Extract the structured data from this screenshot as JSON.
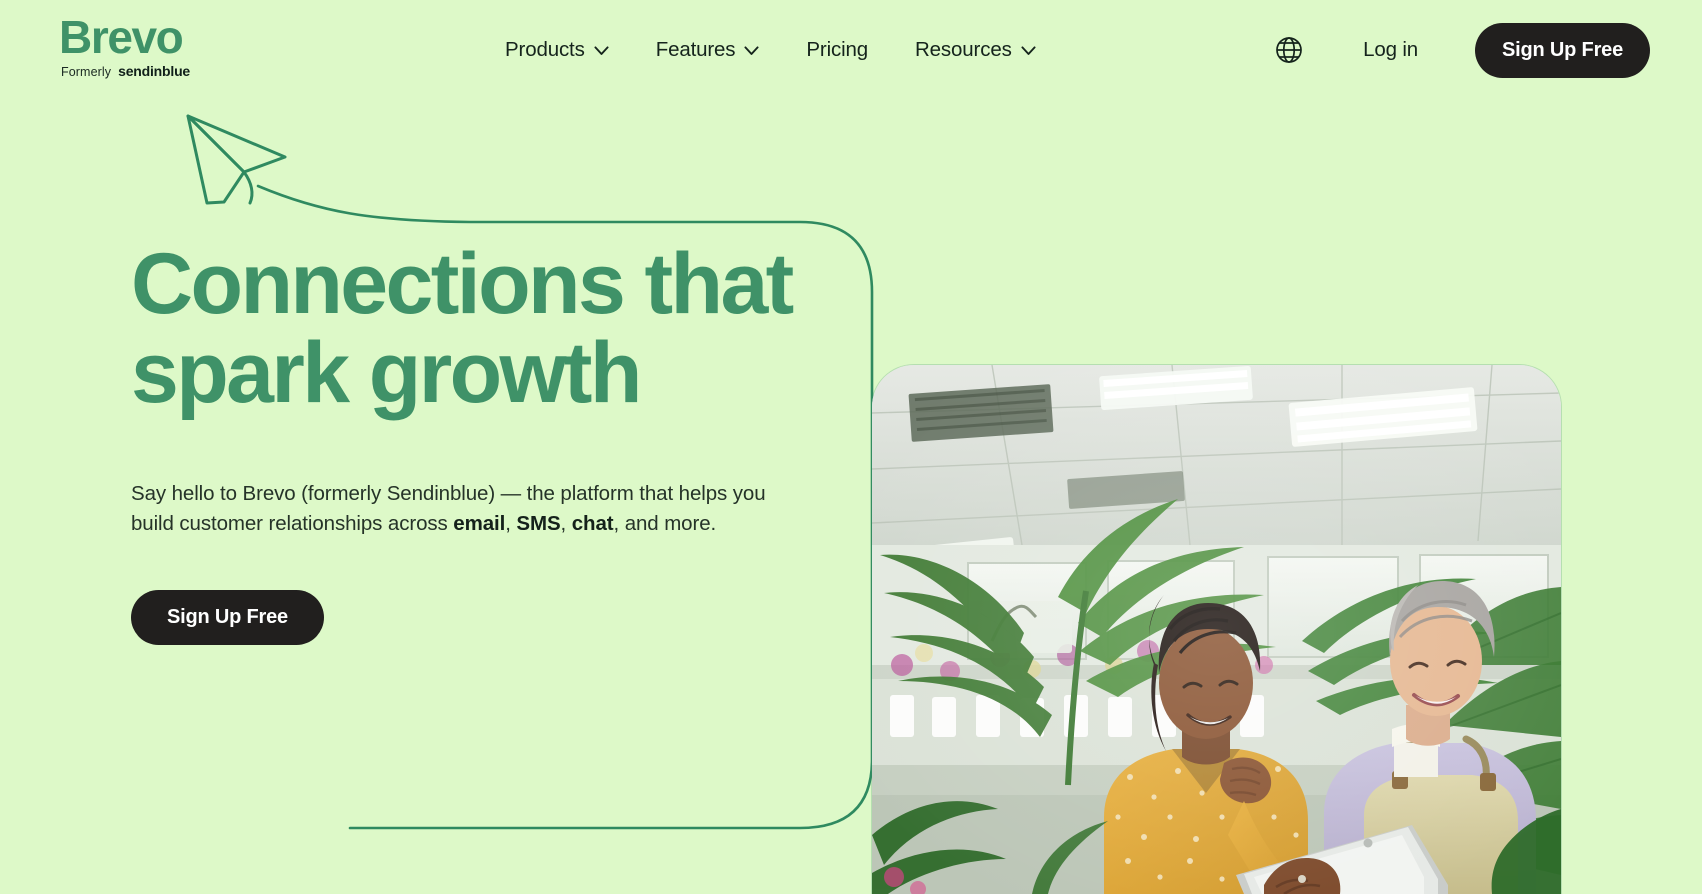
{
  "brand": {
    "logo_name": "Brevo",
    "logo_formerly": "Formerly",
    "logo_former_name": "sendinblue",
    "accent_green": "#3f9268",
    "background": "#ddf9c8",
    "dark": "#211f1e"
  },
  "header": {
    "nav": [
      {
        "label": "Products",
        "has_dropdown": true,
        "icon": "chevron-down-icon"
      },
      {
        "label": "Features",
        "has_dropdown": true,
        "icon": "chevron-down-icon"
      },
      {
        "label": "Pricing",
        "has_dropdown": false,
        "icon": ""
      },
      {
        "label": "Resources",
        "has_dropdown": true,
        "icon": "chevron-down-icon"
      }
    ],
    "language_icon": "globe-icon",
    "login_label": "Log in",
    "signup_label": "Sign Up Free"
  },
  "hero": {
    "heading": "Connections that\nspark growth",
    "paragraph_parts": [
      {
        "text": "Say hello to Brevo (formerly Sendinblue) — the platform that helps you build customer relationships across ",
        "bold": false
      },
      {
        "text": "email",
        "bold": true
      },
      {
        "text": ", ",
        "bold": false
      },
      {
        "text": "SMS",
        "bold": true
      },
      {
        "text": ", ",
        "bold": false
      },
      {
        "text": "chat",
        "bold": true
      },
      {
        "text": ", and more.",
        "bold": false
      }
    ],
    "cta_label": "Sign Up Free",
    "decoration_icon": "paper-plane-icon"
  },
  "photo": {
    "alt": "Two women in a plant shop looking at a tablet together",
    "icon": "hero-photo"
  }
}
